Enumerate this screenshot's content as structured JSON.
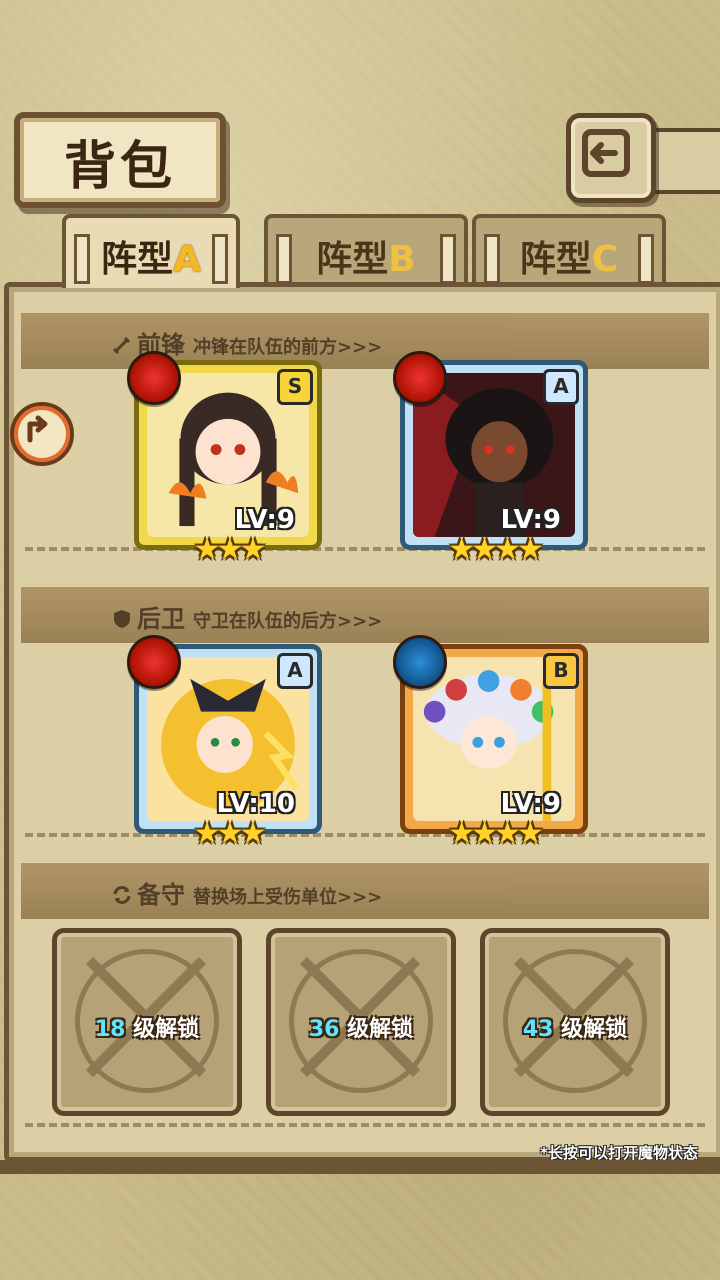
{
  "title": "背包",
  "tabs": [
    {
      "prefix": "阵型",
      "letter": "A",
      "active": true
    },
    {
      "prefix": "阵型",
      "letter": "B",
      "active": false
    },
    {
      "prefix": "阵型",
      "letter": "C",
      "active": false
    }
  ],
  "sections": {
    "front": {
      "title": "前锋",
      "subtitle": "冲锋在队伍的前方>>>"
    },
    "back": {
      "title": "后卫",
      "subtitle": "守卫在队伍的后方>>>"
    },
    "reserve": {
      "title": "备守",
      "subtitle": "替换场上受伤单位>>>"
    }
  },
  "units": [
    {
      "level": "LV:9",
      "rank": "S",
      "element": "fire",
      "stars": 3
    },
    {
      "level": "LV:9",
      "rank": "A",
      "element": "fire",
      "stars": 4
    },
    {
      "level": "LV:10",
      "rank": "A",
      "element": "fire",
      "stars": 3
    },
    {
      "level": "LV:9",
      "rank": "B",
      "element": "water",
      "stars": 4
    }
  ],
  "locked_slots": [
    {
      "num": "18",
      "label": "级解锁"
    },
    {
      "num": "36",
      "label": "级解锁"
    },
    {
      "num": "43",
      "label": "级解锁"
    }
  ],
  "hint": "*长按可以打开魔物状态",
  "stars_text": {
    "three": "★★★",
    "four": "★★★★"
  }
}
